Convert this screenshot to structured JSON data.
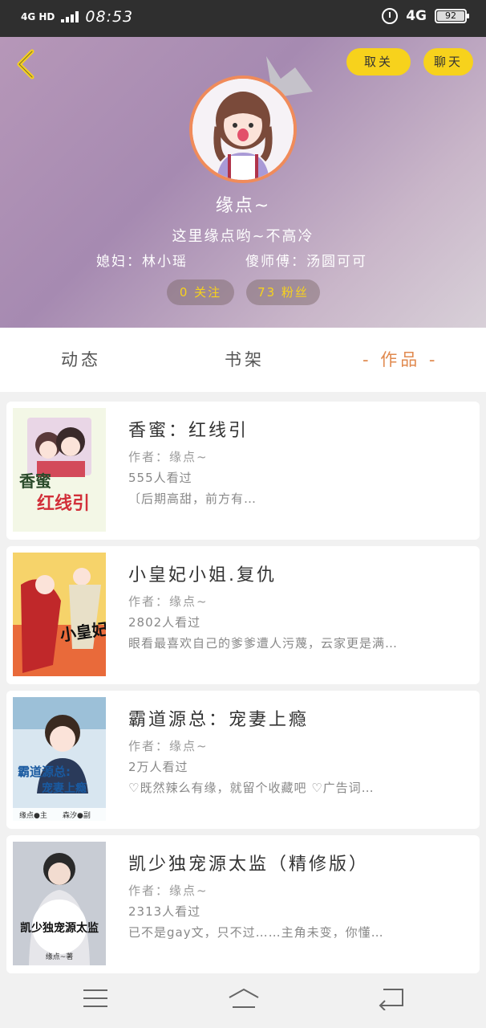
{
  "status_bar": {
    "network": "4G HD",
    "time": "08:53",
    "data": "4G",
    "battery": "92"
  },
  "header": {
    "unfollow_label": "取关",
    "chat_label": "聊天",
    "nickname": "缘点~",
    "bio": "这里缘点哟~不高冷",
    "relation_wife": "媳妇：林小瑶",
    "relation_master": "傻师傅：汤圆可可",
    "follow_count": "0 关注",
    "fans_count": "73 粉丝"
  },
  "tabs": {
    "dynamic": "动态",
    "shelf": "书架",
    "works": "- 作品 -"
  },
  "books": [
    {
      "title": "香蜜：红线引",
      "author": "作者：缘点~",
      "views": "555人看过",
      "desc": "〔后期高甜，前方有…",
      "cover_text": "香蜜",
      "cover_sub": "红线引"
    },
    {
      "title": "小皇妃小姐.复仇",
      "author": "作者：缘点~",
      "views": "2802人看过",
      "desc": "眼看最喜欢自己的爹爹遭人污蔑，云家更是满…",
      "cover_text": "小皇妃小姐"
    },
    {
      "title": "霸道源总：宠妻上瘾",
      "author": "作者：缘点~",
      "views": "2万人看过",
      "desc": "♡既然辣么有缘，就留个收藏吧 ♡广告词…",
      "cover_text": "霸道源总:",
      "cover_sub": "宠妻上瘾",
      "cover_credit1": "缘点●主",
      "cover_credit2": "森汐●副"
    },
    {
      "title": "凯少独宠源太监（精修版）",
      "author": "作者：缘点~",
      "views": "2313人看过",
      "desc": "已不是gay文，只不过……主角未变，你懂…",
      "cover_text": "凯少独宠源太监",
      "cover_credit1": "缘点~著"
    }
  ],
  "colors": {
    "accent": "#f7d21c",
    "tab_active": "#e0894e",
    "avatar_ring": "#f08b5a"
  },
  "icons": [
    "back-chevron-icon",
    "alarm-icon",
    "battery-icon",
    "crown-icon",
    "menu-icon",
    "home-icon",
    "return-icon"
  ]
}
